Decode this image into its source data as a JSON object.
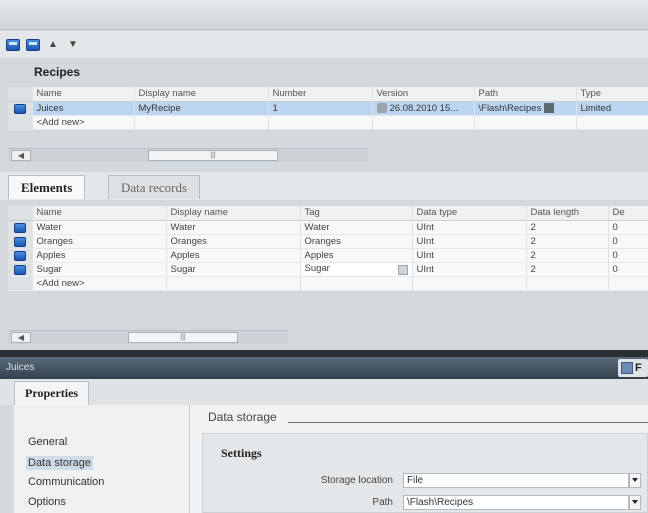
{
  "toolbar": {
    "icons": [
      "add-recipe-icon",
      "add-element-icon",
      "move-up-icon",
      "move-down-icon"
    ],
    "up_glyph": "▲",
    "down_glyph": "▼"
  },
  "recipes": {
    "title": "Recipes",
    "columns": [
      "Name",
      "Display name",
      "Number",
      "Version",
      "Path",
      "Type"
    ],
    "rows": [
      {
        "name": "Juices",
        "display_name": "MyRecipe",
        "number": "1",
        "version": "26.08.2010 15...",
        "path": "\\Flash\\Recipes",
        "type": "Limited"
      }
    ],
    "add_new": "<Add new>"
  },
  "tabs": {
    "elements": "Elements",
    "data_records": "Data records"
  },
  "elements": {
    "columns": [
      "Name",
      "Display name",
      "Tag",
      "Data type",
      "Data length",
      "De"
    ],
    "rows": [
      {
        "name": "Water",
        "display_name": "Water",
        "tag": "Water",
        "data_type": "UInt",
        "data_length": "2",
        "default": "0"
      },
      {
        "name": "Oranges",
        "display_name": "Oranges",
        "tag": "Oranges",
        "data_type": "UInt",
        "data_length": "2",
        "default": "0"
      },
      {
        "name": "Apples",
        "display_name": "Apples",
        "tag": "Apples",
        "data_type": "UInt",
        "data_length": "2",
        "default": "0"
      },
      {
        "name": "Sugar",
        "display_name": "Sugar",
        "tag": "Sugar",
        "data_type": "UInt",
        "data_length": "2",
        "default": "0"
      }
    ],
    "add_new": "<Add new>"
  },
  "inspector": {
    "object_name": "Juices",
    "right_label": "F"
  },
  "properties": {
    "tab": "Properties",
    "nav": [
      "General",
      "Data storage",
      "Communication",
      "Options"
    ],
    "selected_nav": "Data storage",
    "section_title": "Data storage",
    "settings_title": "Settings",
    "storage_location_label": "Storage location",
    "storage_location_value": "File",
    "path_label": "Path",
    "path_value": "\\Flash\\Recipes"
  },
  "colors": {
    "selection": "#bcd6f2",
    "icon_blue": "#1b55b0",
    "inspector_bar": "#34414d"
  }
}
